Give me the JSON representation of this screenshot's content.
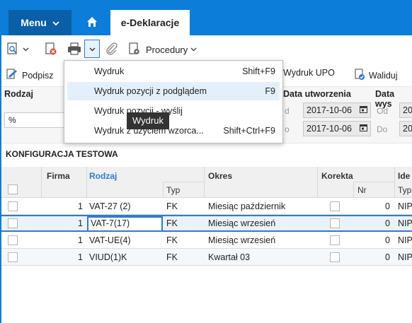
{
  "topbar": {
    "menu_label": "Menu",
    "active_tab": "e-Deklaracje",
    "color": "#0c7dd8"
  },
  "toolbar": {
    "procedures_label": "Procedury"
  },
  "toolbar2": {
    "sign_label": "Podpisz",
    "upo_label": "Wydruk UPO",
    "validate_label": "Waliduj"
  },
  "filters": {
    "rodzaj_label": "Rodzaj",
    "rodzaj_value": "%",
    "created_label": "Data utworzenia",
    "sent_label": "Data wys",
    "created_from": "2017-10-06",
    "created_to": "2017-10-06",
    "sent_from": "20",
    "sent_to": "20",
    "from_short": "d",
    "to_short": "o",
    "from_label": "Od",
    "to_label": "Do"
  },
  "dropdown": {
    "items": [
      {
        "label": "Wydruk",
        "shortcut": "Shift+F9"
      },
      {
        "label": "Wydruk pozycji z podglądem",
        "shortcut": "F9"
      },
      {
        "label": "Wydruk pozycji - wyślij",
        "shortcut": ""
      },
      {
        "label": "Wydruk z użyciem wzorca...",
        "shortcut": "Shift+Ctrl+F9"
      }
    ]
  },
  "tooltip": "Wydruk",
  "section_title": "KONFIGURACJA TESTOWA",
  "grid": {
    "headers": {
      "firma": "Firma",
      "rodzaj": "Rodzaj",
      "typ": "Typ",
      "okres": "Okres",
      "korekta": "Korekta",
      "nr": "Nr",
      "ide": "Ide",
      "typ2": "Typ"
    },
    "rows": [
      {
        "firma": "1",
        "rodzaj": "VAT-27 (2)",
        "typ": "FK",
        "okres": "Miesiąc październik",
        "nr": "0",
        "ide": "NIP"
      },
      {
        "firma": "1",
        "rodzaj": "VAT-7(17)",
        "typ": "FK",
        "okres": "Miesiąc wrzesień",
        "nr": "0",
        "ide": "NIP"
      },
      {
        "firma": "1",
        "rodzaj": "VAT-UE(4)",
        "typ": "FK",
        "okres": "Miesiąc wrzesień",
        "nr": "0",
        "ide": "NIP"
      },
      {
        "firma": "1",
        "rodzaj": "VIUD(1)K",
        "typ": "FK",
        "okres": "Kwartał 03",
        "nr": "0",
        "ide": "NIP"
      }
    ]
  }
}
